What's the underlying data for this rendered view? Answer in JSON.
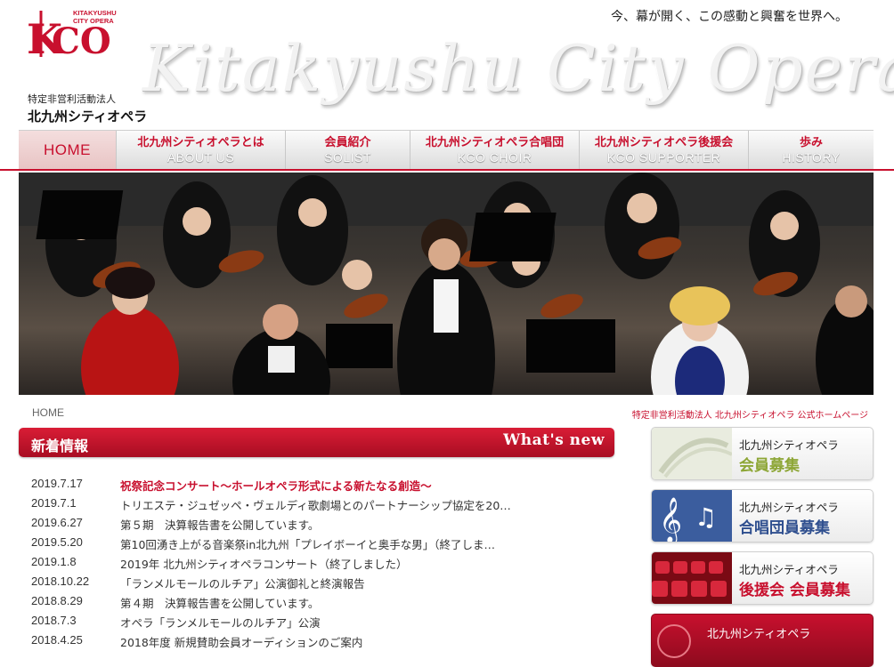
{
  "header": {
    "logo_sub": "KITAKYUSHU\nCITY OPERA",
    "org_type": "特定非営利活動法人",
    "org_name": "北九州シティオペラ",
    "tagline": "今、幕が開く、この感動と興奮を世界へ。",
    "title_script": "Kitakyushu City Opera"
  },
  "nav": {
    "items": [
      {
        "jp": "",
        "en": "HOME",
        "active": true
      },
      {
        "jp": "北九州シティオペラとは",
        "en": "ABOUT US"
      },
      {
        "jp": "会員紹介",
        "en": "SOLIST"
      },
      {
        "jp": "北九州シティオペラ合唱団",
        "en": "KCO CHOIR"
      },
      {
        "jp": "北九州シティオペラ後援会",
        "en": "KCO SUPPORTER"
      },
      {
        "jp": "歩み",
        "en": "HISTORY"
      }
    ]
  },
  "breadcrumb": "HOME",
  "official_note": "特定非営利活動法人 北九州シティオペラ 公式ホームページ",
  "news": {
    "title": "新着情報",
    "title_en": "What's new",
    "items": [
      {
        "date": "2019.7.17",
        "text": "祝祭記念コンサート～ホールオペラ形式による新たなる創造～",
        "highlight": true
      },
      {
        "date": "2019.7.1",
        "text": "トリエステ・ジュゼッペ・ヴェルディ歌劇場とのパートナーシップ協定を20…"
      },
      {
        "date": "2019.6.27",
        "text": "第５期　決算報告書を公開しています。"
      },
      {
        "date": "2019.5.20",
        "text": "第10回湧き上がる音楽祭in北九州「プレイボーイと奥手な男」（終了しま…"
      },
      {
        "date": "2019.1.8",
        "text": "2019年 北九州シティオペラコンサート（終了しました）"
      },
      {
        "date": "2018.10.22",
        "text": "「ランメルモールのルチア」公演御礼と終演報告"
      },
      {
        "date": "2018.8.29",
        "text": "第４期　決算報告書を公開しています。"
      },
      {
        "date": "2018.7.3",
        "text": "オペラ「ランメルモールのルチア」公演"
      },
      {
        "date": "2018.4.25",
        "text": "2018年度 新規賛助会員オーディションのご案内"
      }
    ]
  },
  "banners": [
    {
      "line1": "北九州シティオペラ",
      "line2": "会員募集",
      "icon": "music-hall-icon"
    },
    {
      "line1": "北九州シティオペラ",
      "line2": "合唱団員募集",
      "icon": "treble-clef-icon"
    },
    {
      "line1": "北九州シティオペラ",
      "line2": "後援会 会員募集",
      "icon": "theater-seats-icon"
    },
    {
      "line1": "北九州シティオペラ",
      "line2": "",
      "icon": "emblem-icon"
    }
  ],
  "colors": {
    "accent": "#c8102e",
    "green": "#8da636",
    "blue": "#2f4f8f"
  }
}
